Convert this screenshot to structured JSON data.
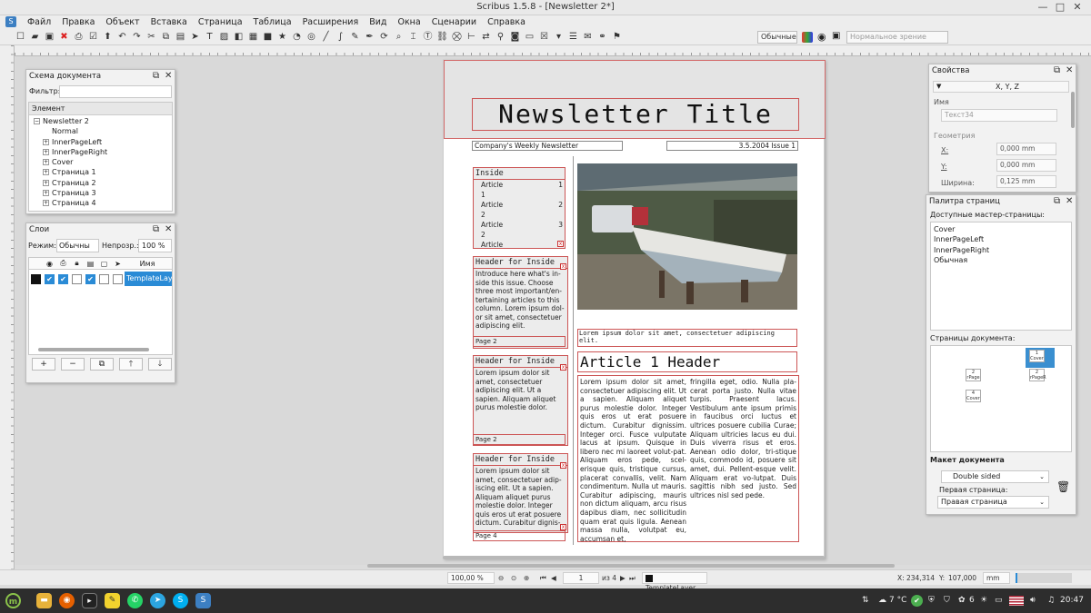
{
  "window": {
    "title": "Scribus 1.5.8 - [Newsletter 2*]",
    "minimize": "—",
    "maximize": "□",
    "close": "✕"
  },
  "menubar": {
    "items": [
      "Файл",
      "Правка",
      "Объект",
      "Вставка",
      "Страница",
      "Таблица",
      "Расширения",
      "Вид",
      "Окна",
      "Сценарии",
      "Справка"
    ]
  },
  "toolbar": {
    "style_select": "Обычные",
    "view_select": "Нормальное зрение"
  },
  "outline_panel": {
    "title": "Схема документа",
    "filter_label": "Фильтр:",
    "filter_value": "",
    "column_header": "Элемент",
    "tree": [
      "Newsletter 2",
      "Normal",
      "InnerPageLeft",
      "InnerPageRight",
      "Cover",
      "Страница 1",
      "Страница 2",
      "Страница 3",
      "Страница 4"
    ]
  },
  "layers_panel": {
    "title": "Слои",
    "mode_label": "Режим:",
    "mode_value": "Обычны",
    "opacity_label": "Непрозр.:",
    "opacity_value": "100 %",
    "name_header": "Имя",
    "layer_name": "TemplateLayer",
    "buttons": [
      "+",
      "−",
      "⧉",
      "🡑",
      "🡓"
    ]
  },
  "document": {
    "newsletter_title": "Newsletter Title",
    "subtitle_left": "Company's Weekly Newsletter",
    "subtitle_right": "3.5.2004 Issue 1",
    "inside": {
      "header": "Inside",
      "rows": [
        {
          "label": "Article",
          "num": "1"
        },
        {
          "label": "1",
          "num": ""
        },
        {
          "label": "Article",
          "num": "2"
        },
        {
          "label": "2",
          "num": ""
        },
        {
          "label": "Article",
          "num": "3"
        },
        {
          "label": "2",
          "num": ""
        },
        {
          "label": "Article",
          "num": ""
        }
      ]
    },
    "side_boxes": [
      {
        "header": "Header for  Inside",
        "text": "Introduce here what's in-side this issue. Choose three most important/en-tertaining articles to this column. Lorem ipsum dol-or sit amet, consectetuer adipiscing elit.",
        "page": "Page  2"
      },
      {
        "header": "Header for  Inside",
        "text": "Lorem ipsum dolor sit amet, consectetuer adipiscing elit. Ut a sapien. Aliquam aliquet purus molestie dolor.",
        "page": "Page  2"
      },
      {
        "header": "Header for  Inside",
        "text": "Lorem ipsum dolor sit amet, consectetuer adip-iscing elit. Ut a sapien. Aliquam aliquet purus molestie dolor. Integer quis eros ut erat posuere dictum. Curabitur dignis-",
        "page": "Page  4"
      }
    ],
    "caption": "Lorem ipsum dolor sit amet, consectetuer adipiscing elit.",
    "article_header": "Article 1 Header",
    "article_col1": "Lorem ipsum dolor sit amet, consectetuer adipiscing elit. Ut a sapien. Aliquam aliquet purus molestie dolor. Integer quis eros ut erat posuere dictum. Curabitur dignissim. Integer orci. Fusce vulputate lacus at ipsum. Quisque in libero nec mi laoreet volut-pat. Aliquam eros pede, scel-erisque quis, tristique cursus, placerat convallis, velit. Nam condimentum. Nulla ut mauris. Curabitur adipiscing, mauris non dictum aliquam, arcu risus dapibus diam, nec sollicitudin quam erat quis ligula. Aenean massa nulla, volutpat eu, accumsan et,",
    "article_col2": "fringilla eget, odio. Nulla pla-cerat porta justo. Nulla vitae turpis. Praesent lacus. Vestibulum ante ipsum primis in faucibus orci luctus et ultrices posuere cubilia Curae; Aliquam ultricies lacus eu dui. Duis viverra risus et eros. Aenean odio dolor, tri-stique quis, commodo id, posuere sit amet, dui. Pellent-esque velit. Aliquam erat vo-lutpat. Duis sagittis nibh sed justo. Sed ultrices nisl sed pede."
  },
  "properties_panel": {
    "title": "Свойства",
    "xyz_tab": "X, Y, Z",
    "name_label": "Имя",
    "name_value": "Текст34",
    "geometry_label": "Геометрия",
    "x_label": "X:",
    "x_value": "0,000  mm",
    "y_label": "Y:",
    "y_value": "0,000  mm",
    "width_label": "Ширина:",
    "width_value": "0,125  mm"
  },
  "pages_panel": {
    "title": "Палитра страниц",
    "masters_label": "Доступные мастер-страницы:",
    "masters": [
      "Cover",
      "InnerPageLeft",
      "InnerPageRight",
      "Обычная"
    ],
    "doc_pages_label": "Страницы документа:",
    "thumbs": [
      {
        "num": "1",
        "label": "Cover"
      },
      {
        "num": "2",
        "label": "rPage"
      },
      {
        "num": "2",
        "label": "rPageR"
      },
      {
        "num": "4",
        "label": "Cover"
      }
    ],
    "layout_label": "Макет документа",
    "layout_value": "Double sided",
    "first_page_label": "Первая страница:",
    "first_page_value": "Правая страница"
  },
  "statusbar": {
    "zoom": "100,00 %",
    "page_current": "1",
    "page_of": "из 4",
    "layer": "TemplateLayer",
    "x_label": "X:",
    "x_value": "234,314",
    "y_label": "Y:",
    "y_value": "107,000",
    "unit": "mm"
  },
  "taskbar": {
    "temperature": "7 °C",
    "count": "6",
    "clock": "20:47",
    "lang_flag": "EN"
  }
}
